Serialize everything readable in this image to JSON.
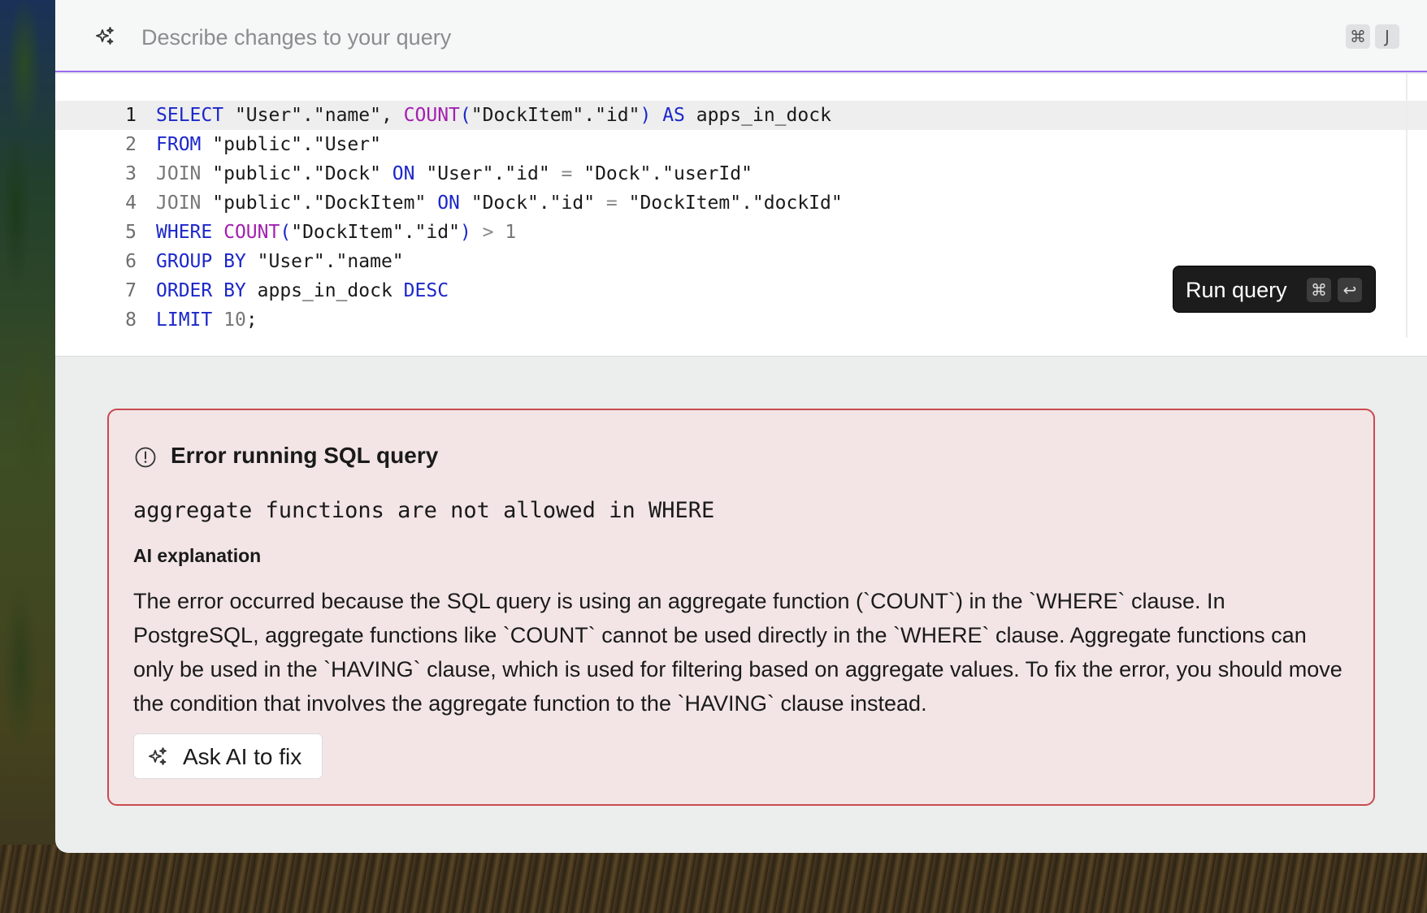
{
  "prompt_bar": {
    "placeholder": "Describe changes to your query",
    "shortcut_cmd": "⌘",
    "shortcut_key": "J",
    "icon": "sparkles-icon"
  },
  "editor": {
    "line_numbers": [
      "1",
      "2",
      "3",
      "4",
      "5",
      "6",
      "7",
      "8"
    ],
    "lines": [
      [
        {
          "t": "SELECT",
          "c": "kw"
        },
        {
          "t": " \"User\".\"name\", "
        },
        {
          "t": "COUNT",
          "c": "fn"
        },
        {
          "t": "(",
          "c": "kw"
        },
        {
          "t": "\"DockItem\".\"id\""
        },
        {
          "t": ")",
          "c": "kw"
        },
        {
          "t": " "
        },
        {
          "t": "AS",
          "c": "kw"
        },
        {
          "t": " apps_in_dock"
        }
      ],
      [
        {
          "t": "FROM",
          "c": "kw"
        },
        {
          "t": " \"public\".\"User\""
        }
      ],
      [
        {
          "t": "JOIN",
          "c": "gray"
        },
        {
          "t": " \"public\".\"Dock\" "
        },
        {
          "t": "ON",
          "c": "kw"
        },
        {
          "t": " \"User\".\"id\" "
        },
        {
          "t": "=",
          "c": "op"
        },
        {
          "t": " \"Dock\".\"userId\""
        }
      ],
      [
        {
          "t": "JOIN",
          "c": "gray"
        },
        {
          "t": " \"public\".\"DockItem\" "
        },
        {
          "t": "ON",
          "c": "kw"
        },
        {
          "t": " \"Dock\".\"id\" "
        },
        {
          "t": "=",
          "c": "op"
        },
        {
          "t": " \"DockItem\".\"dockId\""
        }
      ],
      [
        {
          "t": "WHERE",
          "c": "kw"
        },
        {
          "t": " "
        },
        {
          "t": "COUNT",
          "c": "fn"
        },
        {
          "t": "(",
          "c": "kw"
        },
        {
          "t": "\"DockItem\".\"id\""
        },
        {
          "t": ")",
          "c": "kw"
        },
        {
          "t": " "
        },
        {
          "t": ">",
          "c": "op"
        },
        {
          "t": " 1",
          "c": "gray"
        }
      ],
      [
        {
          "t": "GROUP BY",
          "c": "kw"
        },
        {
          "t": " \"User\".\"name\""
        }
      ],
      [
        {
          "t": "ORDER BY",
          "c": "kw"
        },
        {
          "t": " apps_in_dock "
        },
        {
          "t": "DESC",
          "c": "kw"
        }
      ],
      [
        {
          "t": "LIMIT",
          "c": "kw"
        },
        {
          "t": " "
        },
        {
          "t": "10",
          "c": "gray"
        },
        {
          "t": ";"
        }
      ]
    ],
    "active_line": 1
  },
  "run_button": {
    "label": "Run query",
    "shortcut_cmd": "⌘",
    "shortcut_enter": "↩"
  },
  "error": {
    "title": "Error running SQL query",
    "message": "aggregate functions are not allowed in WHERE",
    "ai_heading": "AI explanation",
    "ai_explanation": "The error occurred because the SQL query is using an aggregate function (`COUNT`) in the `WHERE` clause. In PostgreSQL, aggregate functions like `COUNT` cannot be used directly in the `WHERE` clause. Aggregate functions can only be used in the `HAVING` clause, which is used for filtering based on aggregate values. To fix the error, you should move the condition that involves the aggregate function to the `HAVING` clause instead.",
    "ask_button_label": "Ask AI to fix",
    "icon": "alert-circle-icon"
  },
  "colors": {
    "accent": "#9b6cf0",
    "error_border": "#c94a4f",
    "error_bg": "#f3e5e5",
    "keyword": "#1c27c9",
    "function": "#a320b0"
  }
}
